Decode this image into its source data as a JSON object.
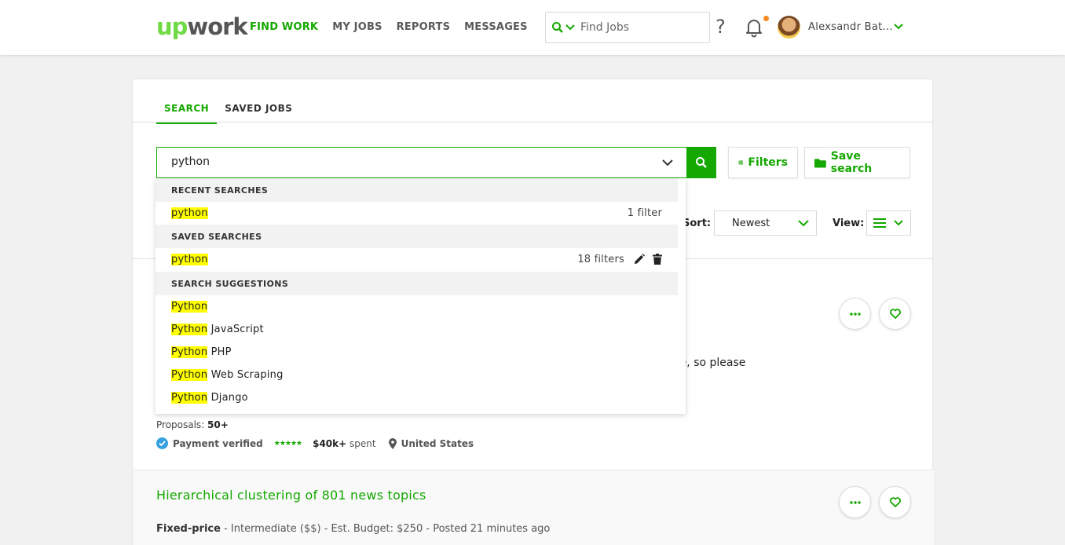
{
  "header": {
    "logo": {
      "up": "up",
      "work": "work"
    },
    "nav": [
      {
        "label": "FIND WORK",
        "active": true
      },
      {
        "label": "MY JOBS",
        "active": false
      },
      {
        "label": "REPORTS",
        "active": false
      },
      {
        "label": "MESSAGES",
        "active": false
      }
    ],
    "search_placeholder": "Find Jobs",
    "help": "?",
    "user_name": "Alexsandr Bat..."
  },
  "tabs": [
    {
      "label": "SEARCH",
      "active": true
    },
    {
      "label": "SAVED JOBS",
      "active": false
    }
  ],
  "search": {
    "value": "python",
    "filters_label": "Filters",
    "save_label": "Save search"
  },
  "sort": {
    "label": "Sort:",
    "value": "Newest"
  },
  "view": {
    "label": "View:"
  },
  "dropdown": {
    "recent_header": "RECENT SEARCHES",
    "recent": [
      {
        "term": "python",
        "meta": "1 filter"
      }
    ],
    "saved_header": "SAVED SEARCHES",
    "saved": [
      {
        "term": "python",
        "meta": "18 filters"
      }
    ],
    "suggest_header": "SEARCH SUGGESTIONS",
    "suggestions": [
      {
        "hl": "Python",
        "rest": ""
      },
      {
        "hl": "Python",
        "rest": " JavaScript"
      },
      {
        "hl": "Python",
        "rest": " PHP"
      },
      {
        "hl": "Python",
        "rest": " Web Scraping"
      },
      {
        "hl": "Python",
        "rest": " Django"
      }
    ]
  },
  "job1": {
    "desc_tail": "ce, so please",
    "proposals_label": "Proposals: ",
    "proposals_value": "50+",
    "payment": "Payment verified",
    "stars": "★★★★★",
    "spent_value": "$40k+",
    "spent_label": " spent",
    "country": "United States"
  },
  "job2": {
    "title": "Hierarchical clustering of 801 news topics",
    "type": "Fixed-price",
    "meta_rest": " - Intermediate ($$) - Est. Budget: $250 - Posted 21 minutes ago"
  },
  "colors": {
    "brand": "#14a800",
    "logo_green": "#6fda44",
    "highlight": "#ffff00",
    "notification": "#f58a1f"
  }
}
